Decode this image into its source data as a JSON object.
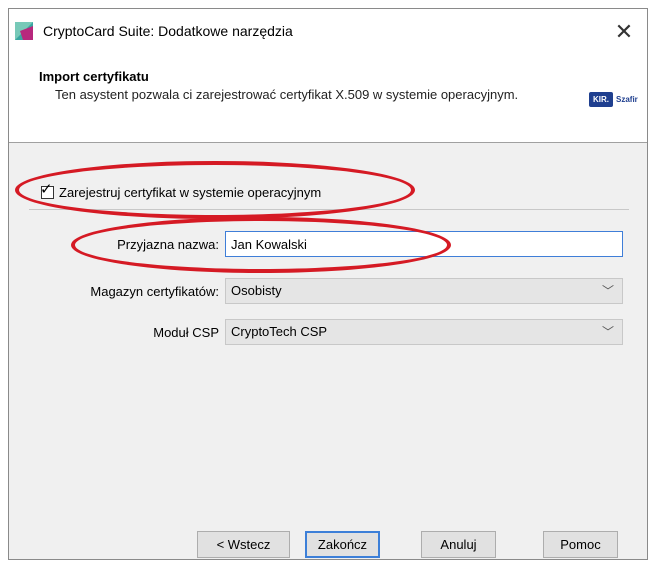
{
  "window": {
    "title": "CryptoCard Suite: Dodatkowe narzędzia",
    "close_glyph": "✕"
  },
  "header": {
    "title": "Import certyfikatu",
    "description": "Ten asystent pozwala ci zarejestrować certyfikat X.509 w systemie operacyjnym.",
    "brand_box": "KIR.",
    "brand_word": "Szafir"
  },
  "form": {
    "register_checkbox": {
      "label": "Zarejestruj certyfikat w systemie operacyjnym",
      "checked": true
    },
    "friendly_name": {
      "label": "Przyjazna nazwa:",
      "value": "Jan Kowalski"
    },
    "cert_store": {
      "label": "Magazyn certyfikatów:",
      "value": "Osobisty"
    },
    "csp_module": {
      "label": "Moduł CSP",
      "value": "CryptoTech CSP"
    }
  },
  "buttons": {
    "back": "< Wstecz",
    "finish": "Zakończ",
    "cancel": "Anuluj",
    "help": "Pomoc"
  },
  "annotation_color": "#d51a24",
  "icons": [
    "app-icon",
    "close-icon",
    "check-icon",
    "chevron-down-icon"
  ]
}
